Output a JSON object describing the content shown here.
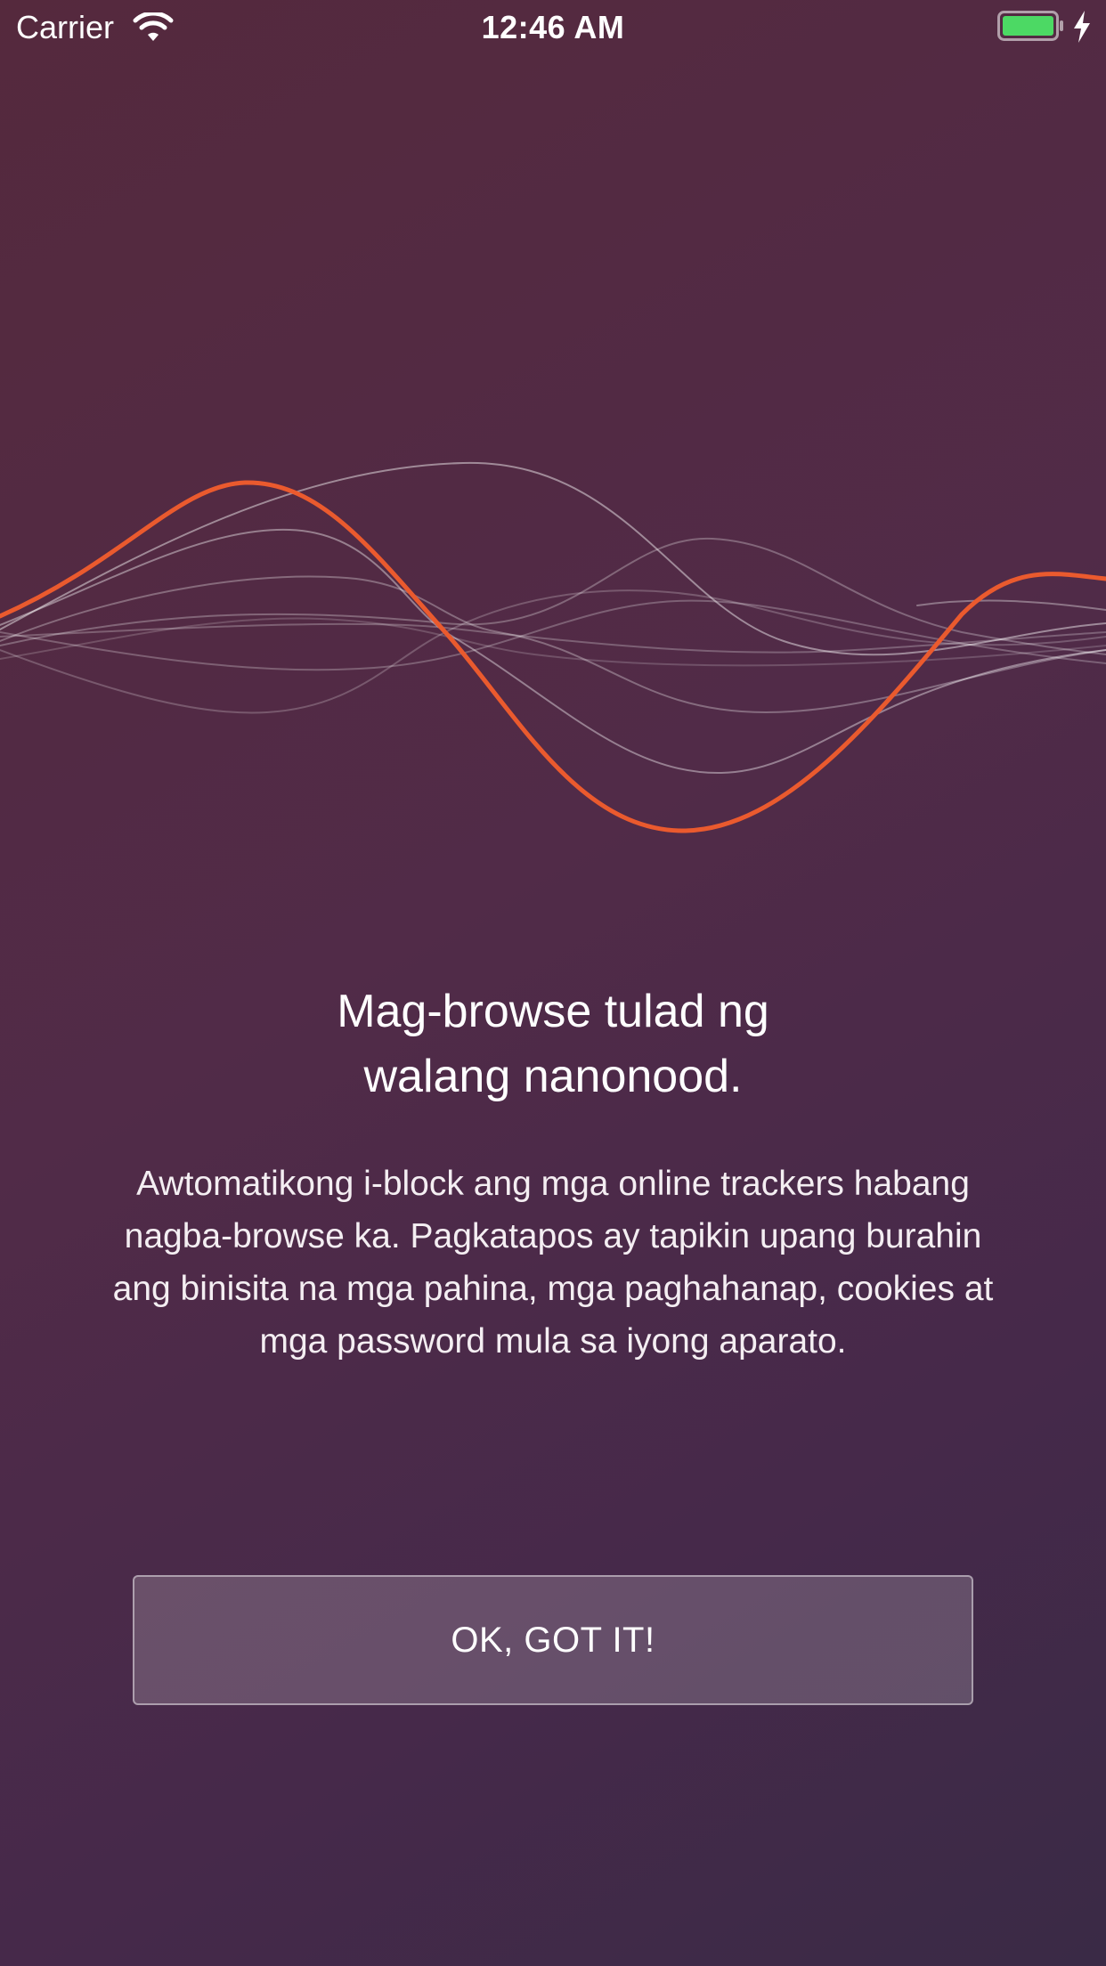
{
  "status_bar": {
    "carrier": "Carrier",
    "time": "12:46 AM",
    "wifi_icon": "wifi-icon",
    "battery_icon": "battery-icon",
    "charging_icon": "charging-bolt-icon",
    "battery_color": "#4cd964"
  },
  "illustration": {
    "icon": "waveform-illustration",
    "accent_color": "#ea5a2e"
  },
  "onboarding": {
    "title_line1": "Mag-browse tulad ng",
    "title_line2": "walang nanonood.",
    "description": "Awtomatikong i-block ang mga online trackers habang nagba-browse ka. Pagkatapos ay tapikin upang burahin ang binisita na mga pahina, mga paghahanap, cookies at mga password mula sa iyong aparato.",
    "button_label": "OK, GOT IT!"
  }
}
